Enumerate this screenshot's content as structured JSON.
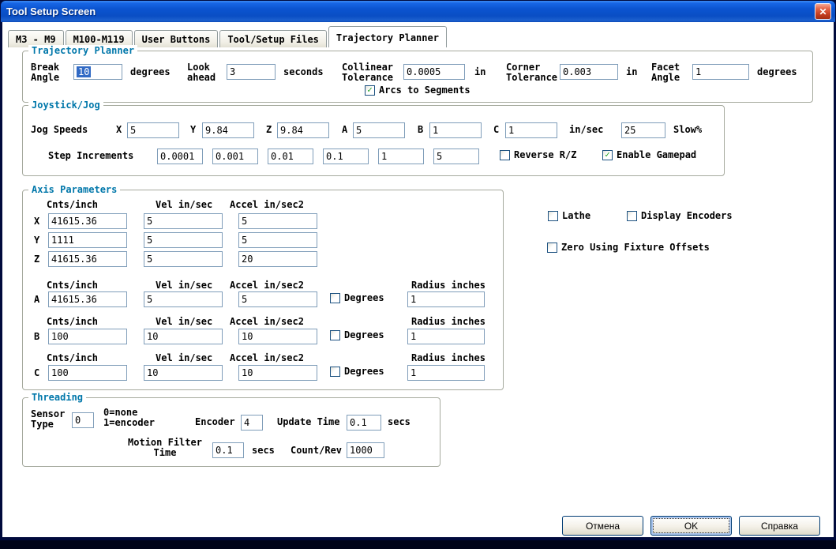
{
  "window": {
    "title": "Tool Setup Screen",
    "close_glyph": "✕"
  },
  "tabs": {
    "items": [
      {
        "label": "M3 - M9"
      },
      {
        "label": "M100-M119"
      },
      {
        "label": "User Buttons"
      },
      {
        "label": "Tool/Setup Files"
      },
      {
        "label": "Trajectory Planner"
      }
    ],
    "active": "Trajectory Planner"
  },
  "colors": {
    "titlebar_blue": "#0A55D2",
    "group_title": "#0077AA",
    "selection_highlight": "#316AC5",
    "check_green": "#21A121",
    "close_red": "#C33D1F"
  },
  "trajectory_planner": {
    "title": "Trajectory Planner",
    "break_angle": {
      "label": "Break\nAngle",
      "value": "10",
      "unit": "degrees"
    },
    "look_ahead": {
      "label": "Look\nahead",
      "value": "3",
      "unit": "seconds"
    },
    "collinear_tolerance": {
      "label": "Collinear\nTolerance",
      "value": "0.0005",
      "unit": "in"
    },
    "corner_tolerance": {
      "label": "Corner\nTolerance",
      "value": "0.003",
      "unit": "in"
    },
    "facet_angle": {
      "label": "Facet\nAngle",
      "value": "1",
      "unit": "degrees"
    },
    "arcs_to_segments": {
      "label": "Arcs to Segments",
      "checked": true
    }
  },
  "joystick_jog": {
    "title": "Joystick/Jog",
    "jog_speeds_label": "Jog Speeds",
    "speeds": [
      {
        "axis": "X",
        "value": "5"
      },
      {
        "axis": "Y",
        "value": "9.84"
      },
      {
        "axis": "Z",
        "value": "9.84"
      },
      {
        "axis": "A",
        "value": "5"
      },
      {
        "axis": "B",
        "value": "1"
      },
      {
        "axis": "C",
        "value": "1"
      }
    ],
    "speed_unit": "in/sec",
    "slow": {
      "value": "25",
      "label": "Slow%"
    },
    "step_increments_label": "Step Increments",
    "step_increments": [
      "0.0001",
      "0.001",
      "0.01",
      "0.1",
      "1",
      "5"
    ],
    "reverse_rz": {
      "label": "Reverse R/Z",
      "checked": false
    },
    "enable_gamepad": {
      "label": "Enable Gamepad",
      "checked": true
    }
  },
  "axis_parameters": {
    "title": "Axis Parameters",
    "headers": {
      "cnts": "Cnts/inch",
      "vel": "Vel in/sec",
      "accel": "Accel in/sec2",
      "radius": "Radius inches"
    },
    "x": {
      "axis": "X",
      "cnts": "41615.36",
      "vel": "5",
      "accel": "5"
    },
    "y": {
      "axis": "Y",
      "cnts": "1111",
      "vel": "5",
      "accel": "5"
    },
    "z": {
      "axis": "Z",
      "cnts": "41615.36",
      "vel": "5",
      "accel": "20"
    },
    "a": {
      "axis": "A",
      "cnts": "41615.36",
      "vel": "5",
      "accel": "5",
      "degrees_label": "Degrees",
      "degrees_checked": false,
      "radius": "1"
    },
    "b": {
      "axis": "B",
      "cnts": "100",
      "vel": "10",
      "accel": "10",
      "degrees_label": "Degrees",
      "degrees_checked": false,
      "radius": "1"
    },
    "c": {
      "axis": "C",
      "cnts": "100",
      "vel": "10",
      "accel": "10",
      "degrees_label": "Degrees",
      "degrees_checked": false,
      "radius": "1"
    }
  },
  "options": {
    "lathe": {
      "label": "Lathe",
      "checked": false
    },
    "display_encoders": {
      "label": "Display Encoders",
      "checked": false
    },
    "zero_using_fixture_offsets": {
      "label": "Zero Using Fixture Offsets",
      "checked": false
    }
  },
  "threading": {
    "title": "Threading",
    "sensor_type": {
      "label": "Sensor\nType",
      "value": "0",
      "note": "0=none\n1=encoder"
    },
    "encoder": {
      "label": "Encoder",
      "value": "4"
    },
    "update_time": {
      "label": "Update Time",
      "value": "0.1",
      "unit": "secs"
    },
    "motion_filter": {
      "label": "Motion Filter\nTime",
      "value": "0.1",
      "unit": "secs"
    },
    "count_per_rev": {
      "label": "Count/Rev",
      "value": "1000"
    }
  },
  "buttons": {
    "cancel": "Отмена",
    "ok": "OK",
    "help": "Справка"
  }
}
